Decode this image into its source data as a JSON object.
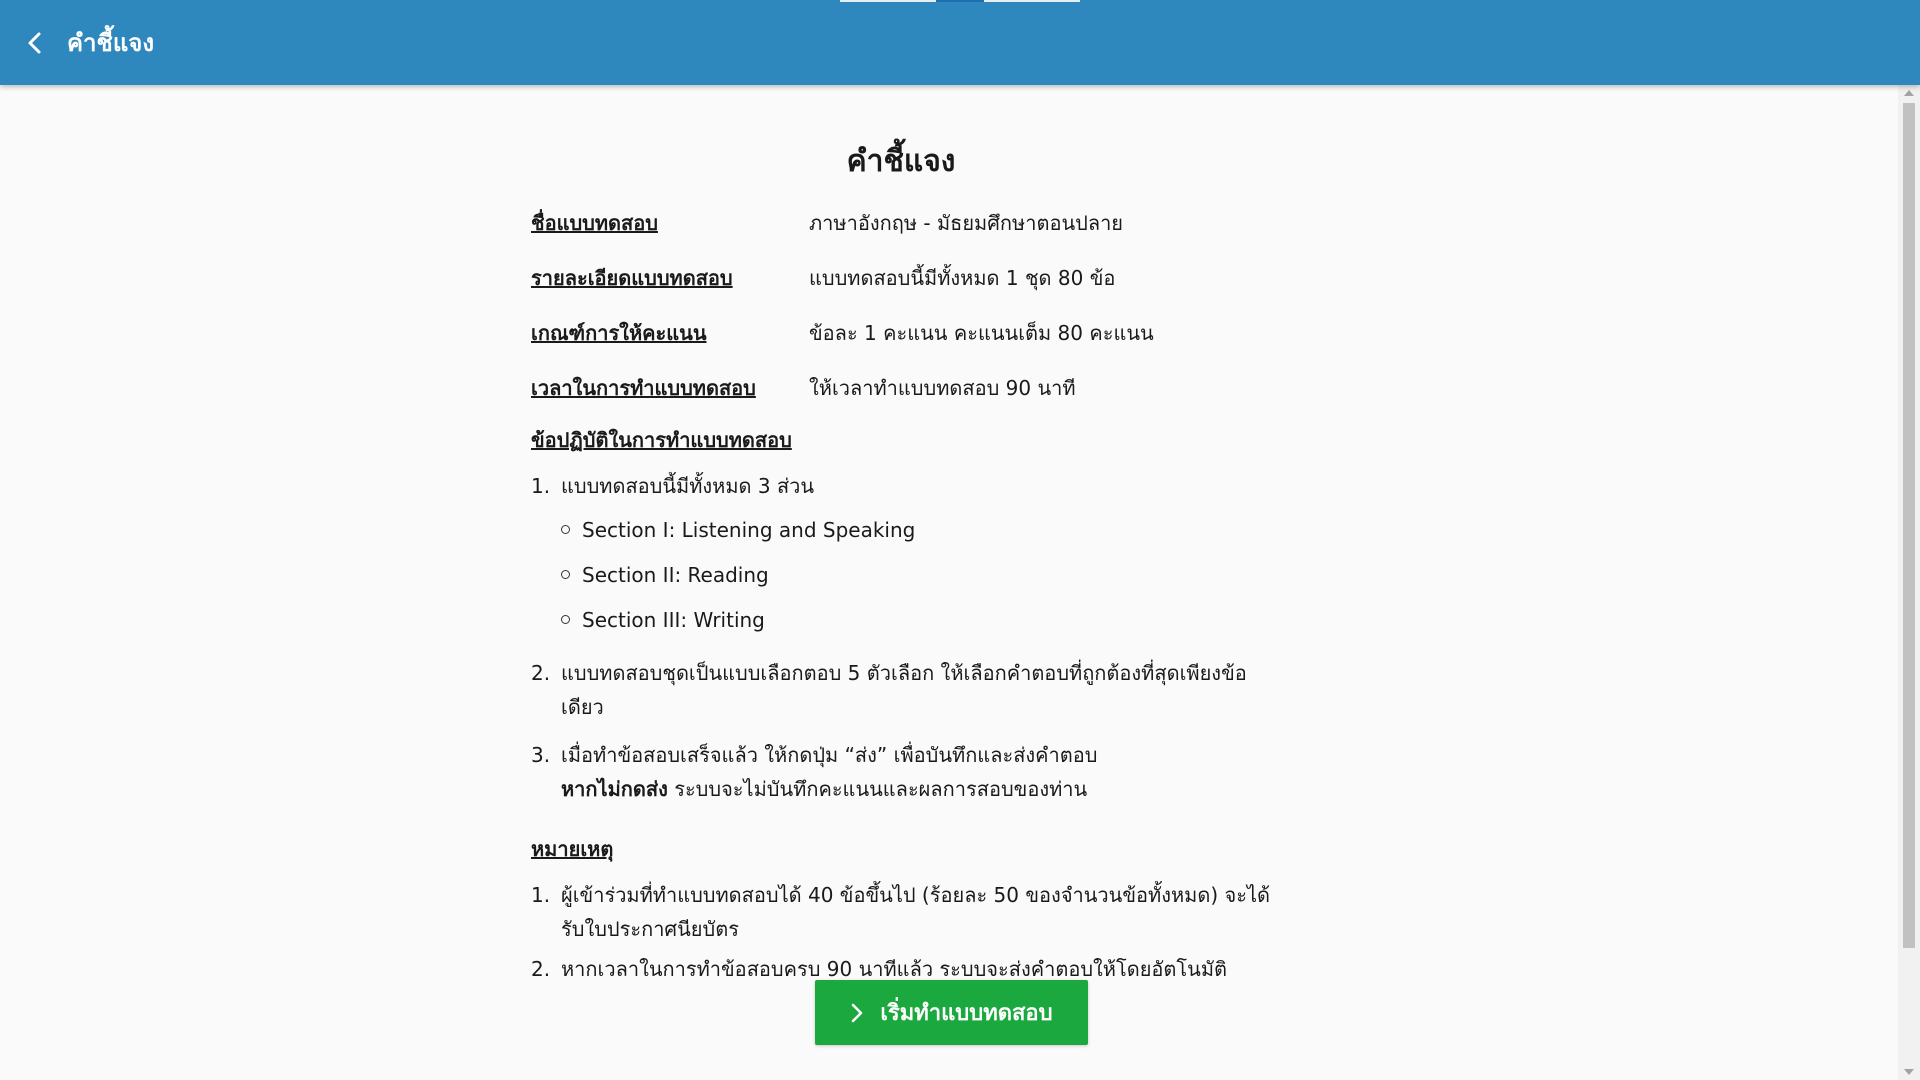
{
  "header": {
    "title": "คำชี้แจง",
    "back_icon": "chevron-left-icon",
    "background_color": "#2e88be"
  },
  "main": {
    "title": "คำชี้แจง",
    "info": [
      {
        "label": "ชื่อแบบทดสอบ",
        "value": "ภาษาอังกฤษ - มัธยมศึกษาตอนปลาย"
      },
      {
        "label": "รายละเอียดแบบทดสอบ",
        "value": "แบบทดสอบนี้มีทั้งหมด 1 ชุด 80 ข้อ"
      },
      {
        "label": "เกณฑ์การให้คะแนน",
        "value": "ข้อละ 1 คะแนน คะแนนเต็ม 80 คะแนน"
      },
      {
        "label": "เวลาในการทำแบบทดสอบ",
        "value": "ให้เวลาทำแบบทดสอบ 90 นาที"
      }
    ],
    "instructions": {
      "heading": "ข้อปฏิบัติในการทำแบบทดสอบ",
      "items": [
        {
          "num": "1.",
          "text": "แบบทดสอบนี้มีทั้งหมด 3 ส่วน",
          "sub": [
            "Section I: Listening and Speaking",
            "Section II: Reading",
            "Section III: Writing"
          ]
        },
        {
          "num": "2.",
          "text": "แบบทดสอบชุดเป็นแบบเลือกตอบ 5 ตัวเลือก ให้เลือกคำตอบที่ถูกต้องที่สุดเพียงข้อเดียว"
        },
        {
          "num": "3.",
          "text": "เมื่อทำข้อสอบเสร็จแล้ว ให้กดปุ่ม “ส่ง” เพื่อบันทึกและส่งคำตอบ",
          "bold": "หากไม่กดส่ง",
          "rest": " ระบบจะไม่บันทึกคะแนนและผลการสอบของท่าน"
        }
      ]
    },
    "notes": {
      "heading": "หมายเหตุ",
      "items": [
        {
          "num": "1.",
          "text": "ผู้เข้าร่วมที่ทำแบบทดสอบได้ 40 ข้อขึ้นไป (ร้อยละ 50 ของจำนวนข้อทั้งหมด) จะได้รับใบประกาศนียบัตร"
        },
        {
          "num": "2.",
          "text": "หากเวลาในการทำข้อสอบครบ 90 นาทีแล้ว ระบบจะส่งคำตอบให้โดยอัตโนมัติ"
        }
      ]
    },
    "start_button": {
      "label": "เริ่มทำแบบทดสอบ",
      "icon": "chevron-right-icon",
      "color": "#1ba83e"
    }
  }
}
